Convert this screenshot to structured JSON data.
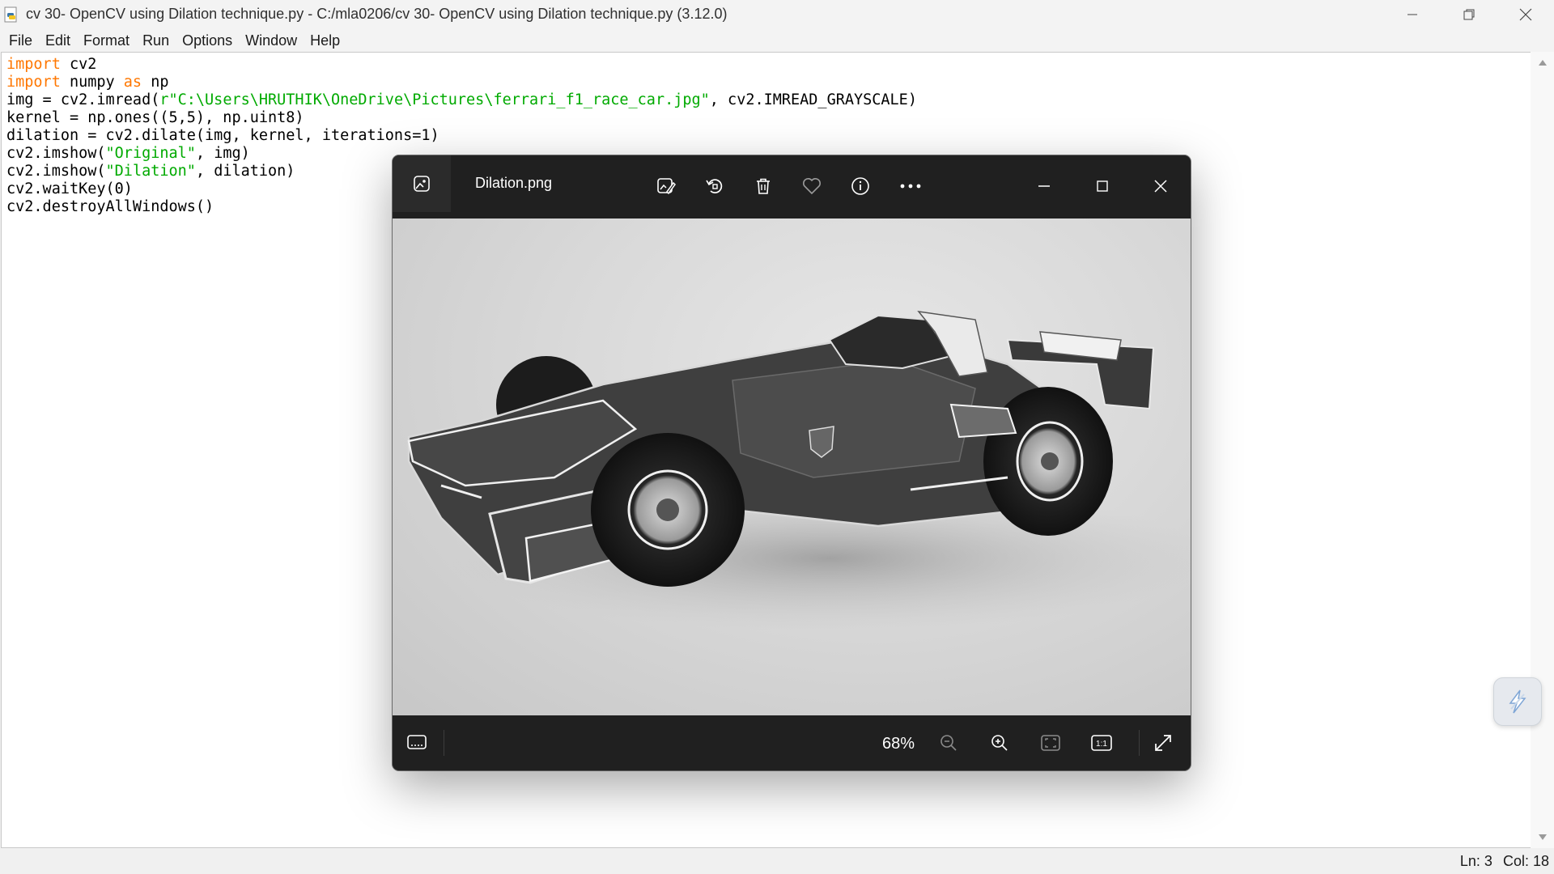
{
  "window": {
    "title": "cv 30- OpenCV using Dilation technique.py - C:/mla0206/cv 30- OpenCV using Dilation technique.py (3.12.0)"
  },
  "menu": [
    "File",
    "Edit",
    "Format",
    "Run",
    "Options",
    "Window",
    "Help"
  ],
  "code_lines": [
    [
      {
        "t": "import",
        "c": "kw"
      },
      {
        "t": " cv2",
        "c": ""
      }
    ],
    [
      {
        "t": "import",
        "c": "kw"
      },
      {
        "t": " numpy ",
        "c": ""
      },
      {
        "t": "as",
        "c": "kw"
      },
      {
        "t": " np",
        "c": ""
      }
    ],
    [
      {
        "t": "img = cv2.imread(",
        "c": ""
      },
      {
        "t": "r\"C:\\Users\\HRUTHIK\\OneDrive\\Pictures\\ferrari_f1_race_car.jpg\"",
        "c": "str"
      },
      {
        "t": ", cv2.IMREAD_GRAYSCALE)",
        "c": ""
      }
    ],
    [
      {
        "t": "kernel = np.ones((5,5), np.uint8)",
        "c": ""
      }
    ],
    [
      {
        "t": "dilation = cv2.dilate(img, kernel, iterations=1)",
        "c": ""
      }
    ],
    [
      {
        "t": "cv2.imshow(",
        "c": ""
      },
      {
        "t": "\"Original\"",
        "c": "str"
      },
      {
        "t": ", img)",
        "c": ""
      }
    ],
    [
      {
        "t": "cv2.imshow(",
        "c": ""
      },
      {
        "t": "\"Dilation\"",
        "c": "str"
      },
      {
        "t": ", dilation)",
        "c": ""
      }
    ],
    [
      {
        "t": "cv2.waitKey(0)",
        "c": ""
      }
    ],
    [
      {
        "t": "cv2.destroyAllWindows()",
        "c": ""
      }
    ]
  ],
  "status": {
    "line": "Ln: 3",
    "col": "Col: 18"
  },
  "viewer": {
    "filename": "Dilation.png",
    "zoom": "68%",
    "fit_label": "1:1",
    "image_description_icon": "race-car-photo"
  },
  "colors": {
    "keyword": "#ff7700",
    "string": "#00aa00",
    "viewer_bg": "#202020"
  }
}
